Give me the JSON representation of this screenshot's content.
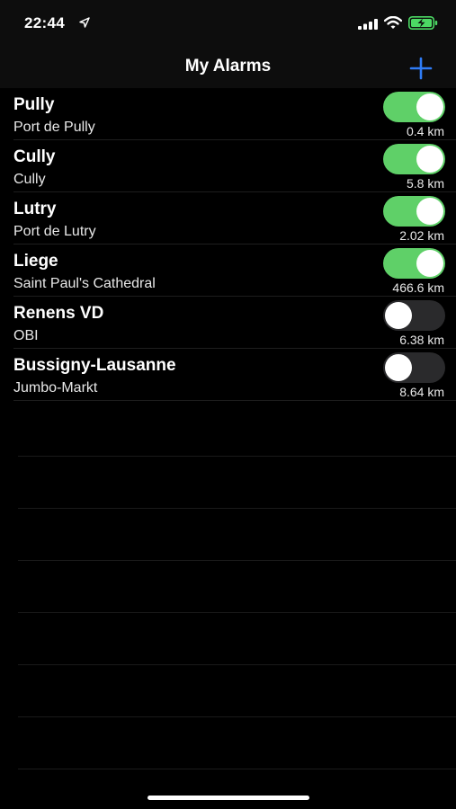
{
  "status_bar": {
    "time": "22:44",
    "icons": [
      "location-arrow-icon",
      "cellular-signal-icon",
      "wifi-icon",
      "battery-charging-icon"
    ],
    "battery_color": "#4cd964"
  },
  "nav": {
    "title": "My Alarms",
    "add_icon": "plus-icon",
    "accent_color": "#2f7cf6"
  },
  "alarms": [
    {
      "title": "Pully",
      "subtitle": "Port de Pully",
      "distance": "0.4 km",
      "enabled": true
    },
    {
      "title": "Cully",
      "subtitle": "Cully",
      "distance": "5.8 km",
      "enabled": true
    },
    {
      "title": "Lutry",
      "subtitle": "Port de Lutry",
      "distance": "2.02 km",
      "enabled": true
    },
    {
      "title": "Liege",
      "subtitle": "Saint Paul's Cathedral",
      "distance": "466.6 km",
      "enabled": true
    },
    {
      "title": "Renens VD",
      "subtitle": "OBI",
      "distance": "6.38 km",
      "enabled": false
    },
    {
      "title": "Bussigny-Lausanne",
      "subtitle": "Jumbo-Markt",
      "distance": "8.64 km",
      "enabled": false
    }
  ],
  "toggle_on_color": "#5fd068"
}
